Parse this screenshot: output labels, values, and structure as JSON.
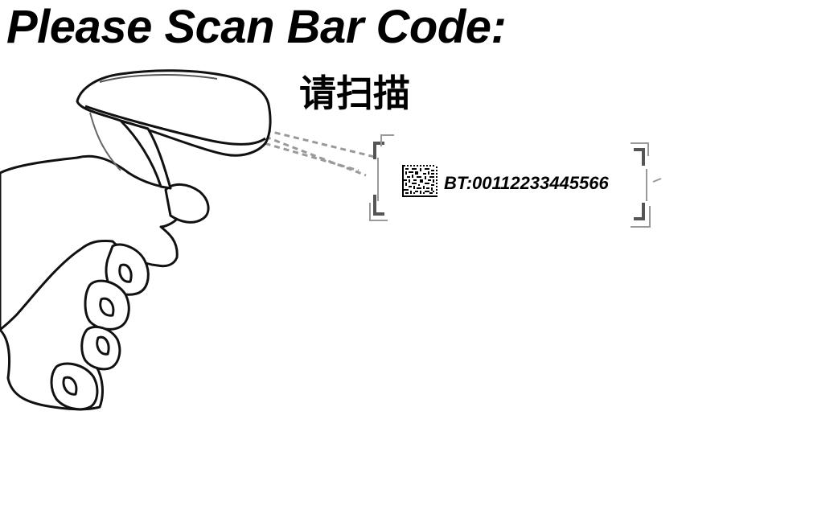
{
  "header": {
    "title": "Please Scan Bar Code:",
    "subtitle": "请扫描"
  },
  "label": {
    "text": "BT:00112233445566"
  },
  "icons": {
    "scanner": "barcode-scanner-in-hand-icon",
    "code": "data-matrix-code-icon"
  },
  "colors": {
    "text": "#000000",
    "background": "#ffffff",
    "scan_beam": "#999999",
    "bracket": "#555555"
  }
}
